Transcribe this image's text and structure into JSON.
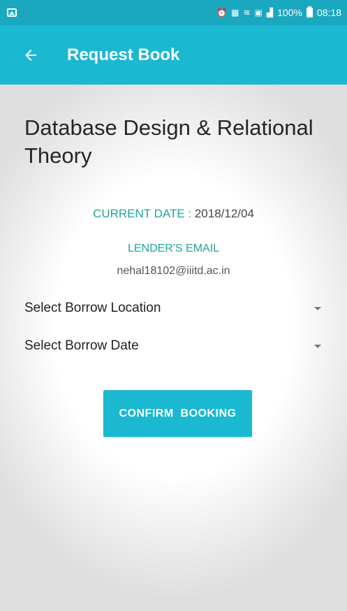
{
  "status_bar": {
    "battery_percent": "100%",
    "time": "08:18",
    "icons": [
      "gallery-icon",
      "alarm-icon",
      "volte-icon",
      "wifi-icon",
      "data-icon",
      "signal-icon",
      "battery-icon"
    ]
  },
  "app_bar": {
    "title": "Request Book",
    "back_icon": "arrow-left-icon",
    "color": "#1bb8d2"
  },
  "book": {
    "title": "Database Design & Relational Theory"
  },
  "current_date": {
    "label": "CURRENT DATE",
    "separator": " : ",
    "value": "2018/12/04"
  },
  "lender": {
    "label": "LENDER'S EMAIL",
    "email": "nehal18102@iiitd.ac.in"
  },
  "spinners": {
    "location": "Select Borrow Location",
    "date": "Select Borrow Date"
  },
  "actions": {
    "confirm_label": "CONFIRM  BOOKING"
  },
  "colors": {
    "accent": "#1bb8d2",
    "label_teal": "#1fa697"
  }
}
